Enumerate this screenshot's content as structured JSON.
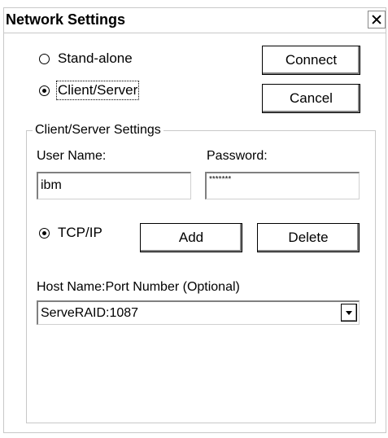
{
  "window": {
    "title": "Network Settings"
  },
  "mode": {
    "standalone_label": "Stand-alone",
    "clientserver_label": "Client/Server",
    "selected": "Client/Server"
  },
  "buttons": {
    "connect": "Connect",
    "cancel": "Cancel",
    "add": "Add",
    "delete": "Delete"
  },
  "group": {
    "legend": "Client/Server Settings",
    "username_label": "User Name:",
    "username_value": "ibm",
    "password_label": "Password:",
    "password_value": "*******",
    "protocol_label": "TCP/IP",
    "host_label": "Host Name:Port Number (Optional)",
    "host_value": "ServeRAID:1087"
  },
  "icons": {
    "close": "close-icon",
    "dropdown": "chevron-down-icon",
    "radio": "radio-icon"
  }
}
